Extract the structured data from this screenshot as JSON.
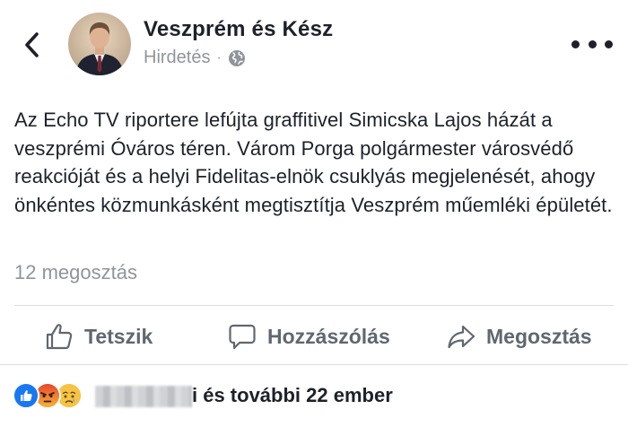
{
  "post": {
    "page_name": "Veszprém és Kész",
    "sponsored_label": "Hirdetés",
    "separator": "·",
    "text": "Az Echo TV riportere lefújta graffitivel Simicska Lajos házát a veszprémi Óváros téren. Várom Porga polgármester városvédő reakcióját és a helyi Fidelitas-elnök csuklyás megjelenését, ahogy önkéntes közmunkásként megtisztítja Veszprém műemléki épületét.",
    "shares": "12 megosztás"
  },
  "actions": {
    "like_label": "Tetszik",
    "comment_label": "Hozzászólás",
    "share_label": "Megosztás"
  },
  "reactions": {
    "names_suffix": "i és további 22 ember",
    "types": [
      "like",
      "angry",
      "sad"
    ]
  },
  "icons": {
    "back": "chevron-left-icon",
    "audience": "globe-icon",
    "more": "more-horizontal-icon",
    "like": "thumbs-up-icon",
    "comment": "speech-bubble-icon",
    "share": "share-arrow-icon"
  },
  "colors": {
    "text": "#1d2129",
    "secondary": "#90949c",
    "action": "#606770",
    "like_blue": "#1877f2",
    "angry_orange": "#f07a1d",
    "sad_yellow": "#f6c344"
  }
}
